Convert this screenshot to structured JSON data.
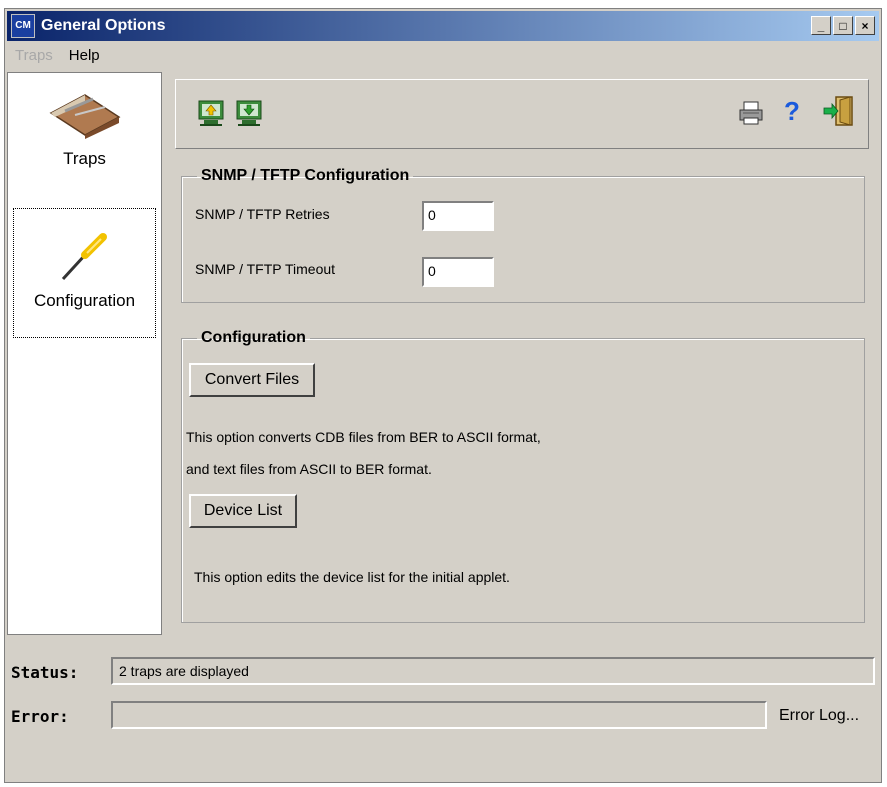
{
  "window": {
    "title": "General Options",
    "app_icon_text": "CM",
    "controls": [
      "_",
      "□",
      "×"
    ]
  },
  "menu": [
    {
      "label": "Traps",
      "enabled": false
    },
    {
      "label": "Help",
      "enabled": true
    }
  ],
  "nav": {
    "items": [
      {
        "label": "Traps",
        "icon": "trap-icon"
      },
      {
        "label": "Configuration",
        "icon": "screwdriver-icon",
        "selected": true
      }
    ]
  },
  "toolbar": {
    "left_icons": [
      "upload-to-computer-icon",
      "download-to-computer-icon"
    ],
    "right_icons": [
      "printer-icon",
      "help-icon",
      "exit-door-icon"
    ],
    "help_glyph": "?"
  },
  "snmp": {
    "legend": "SNMP / TFTP Configuration",
    "retries_label": "SNMP / TFTP Retries",
    "retries_value": "0",
    "timeout_label": "SNMP / TFTP Timeout",
    "timeout_value": "0"
  },
  "configuration": {
    "legend": "Configuration",
    "convert_button": "Convert Files",
    "convert_desc_1": "This option converts CDB files from BER to ASCII format,",
    "convert_desc_2": "and text files from ASCII to BER format.",
    "device_button": "Device List",
    "device_desc": "This option edits the device list for the initial applet."
  },
  "status": {
    "status_label": "Status:",
    "status_value": "2 traps are displayed",
    "error_label": "Error:",
    "error_value": "",
    "error_log_link": "Error Log..."
  },
  "colors": {
    "titlebar_start": "#0a246a",
    "titlebar_end": "#a6caf0",
    "face": "#d4d0c8"
  }
}
